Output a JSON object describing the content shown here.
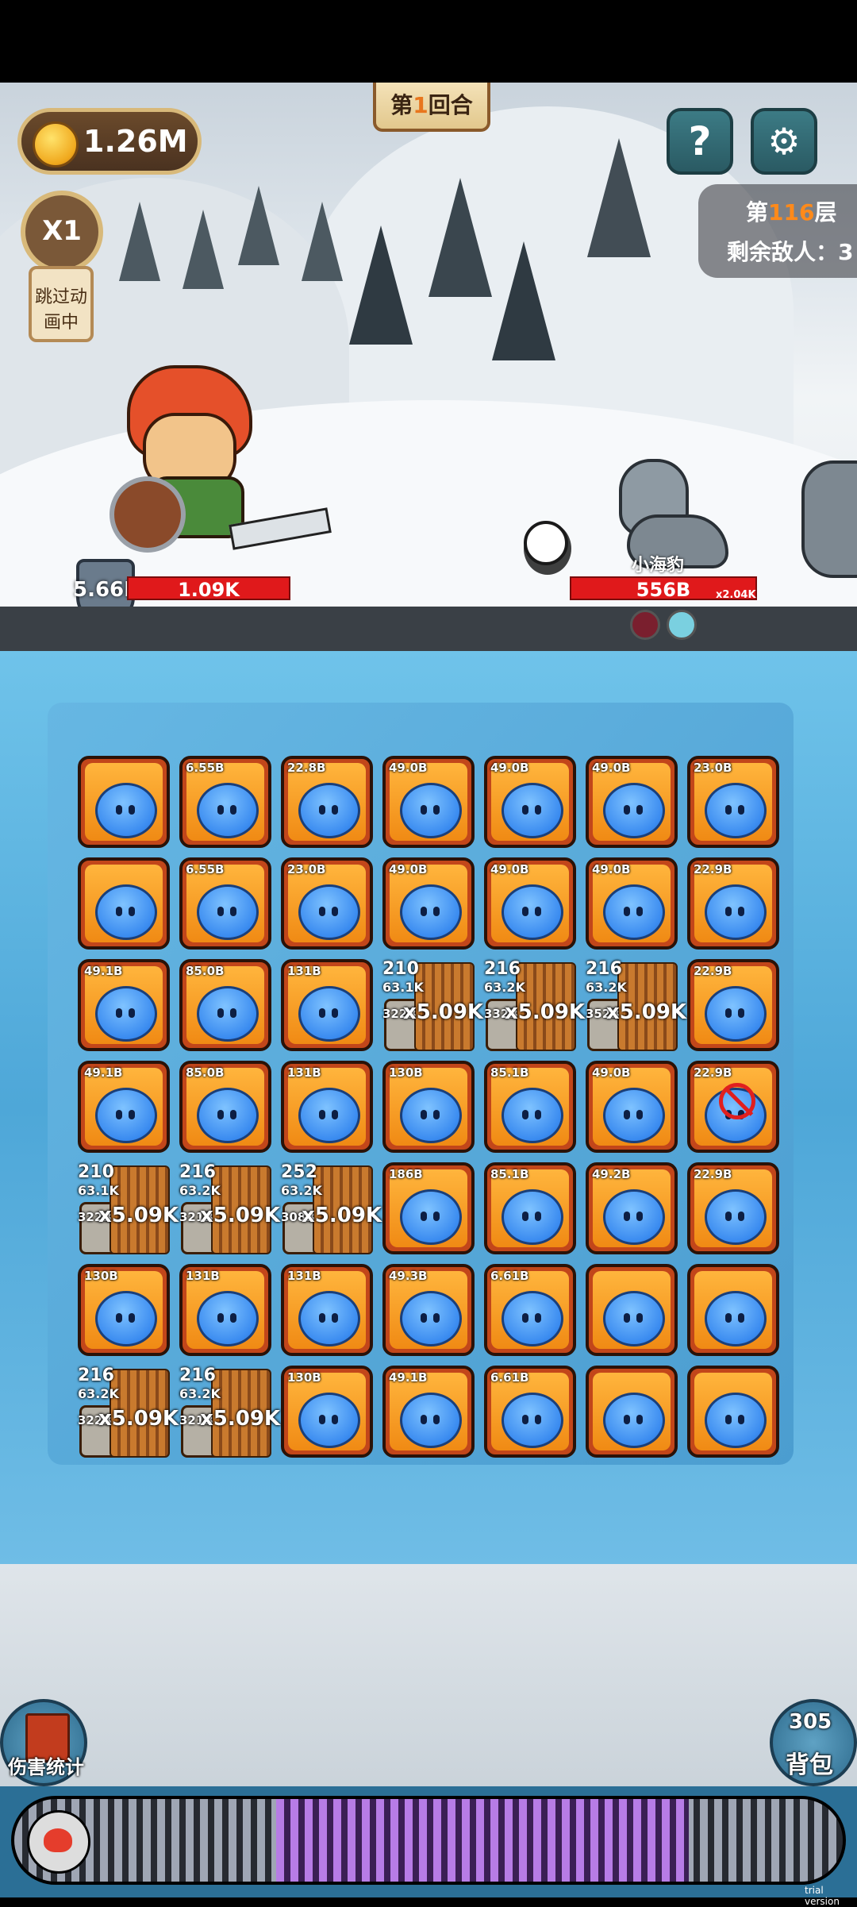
{
  "hud": {
    "round_prefix": "第",
    "round_number": "1",
    "round_suffix": "回合",
    "coins": "1.26M",
    "speed": "X1",
    "skip_animation": "跳过动画中",
    "help_icon": "?",
    "settings_icon": "⚙",
    "floor_prefix": "第",
    "floor_number": "116",
    "floor_suffix": "层",
    "enemies_left": "剩余敌人：3"
  },
  "hero": {
    "shield": "5.66M",
    "hp": "1.09K",
    "buffs": [
      "sword-buff-icon",
      "puzzle-buff-icon",
      "potion-buff-icon"
    ]
  },
  "enemy": {
    "name": "小海豹",
    "hp": "556B",
    "multiplier": "x2.04K",
    "debuffs": [
      "no-attack-icon",
      "ice-icon"
    ]
  },
  "grid": {
    "rows": [
      [
        "",
        "6.55B",
        "22.8B",
        "49.0B",
        "49.0B",
        "49.0B",
        "23.0B"
      ],
      [
        "",
        "6.55B",
        "23.0B",
        "49.0B",
        "49.0B",
        "49.0B",
        "22.9B"
      ],
      [
        "49.1B",
        "85.0B",
        "131B",
        "",
        "",
        "",
        "22.9B"
      ],
      [
        "49.1B",
        "85.0B",
        "131B",
        "130B",
        "85.1B",
        "49.0B",
        "22.9B"
      ],
      [
        "",
        "",
        "",
        "186B",
        "85.1B",
        "49.2B",
        "22.9B"
      ],
      [
        "130B",
        "131B",
        "131B",
        "49.3B",
        "6.61B",
        "",
        ""
      ],
      [
        "",
        "",
        "130B",
        "49.1B",
        "6.61B",
        "",
        ""
      ]
    ],
    "big_tiles": [
      {
        "top": "210",
        "mid": "63.1K",
        "bot": "322B",
        "mult": "x5.09K"
      },
      {
        "top": "216",
        "mid": "63.2K",
        "bot": "332B",
        "mult": "x5.09K"
      },
      {
        "top": "216",
        "mid": "63.2K",
        "bot": "352B",
        "mult": "x5.09K"
      },
      {
        "top": "210",
        "mid": "63.1K",
        "bot": "322B",
        "mult": "x5.09K"
      },
      {
        "top": "216",
        "mid": "63.2K",
        "bot": "321B",
        "mult": "x5.09K"
      },
      {
        "top": "252",
        "mid": "63.2K",
        "bot": "308B",
        "mult": "x5.09K"
      },
      {
        "top": "216",
        "mid": "63.2K",
        "bot": "322B",
        "mult": "x5.09K"
      },
      {
        "top": "216",
        "mid": "63.2K",
        "bot": "321B",
        "mult": "x5.09K"
      }
    ]
  },
  "bottom": {
    "damage_stats": "伤害统计",
    "bag_count": "305",
    "bag_label": "背包",
    "watermark": "trial version"
  },
  "colors": {
    "hp_bar": "#e0191b",
    "ice": "#5aaede",
    "tile_frame": "#f08a14",
    "slime": "#3a8bf0"
  }
}
